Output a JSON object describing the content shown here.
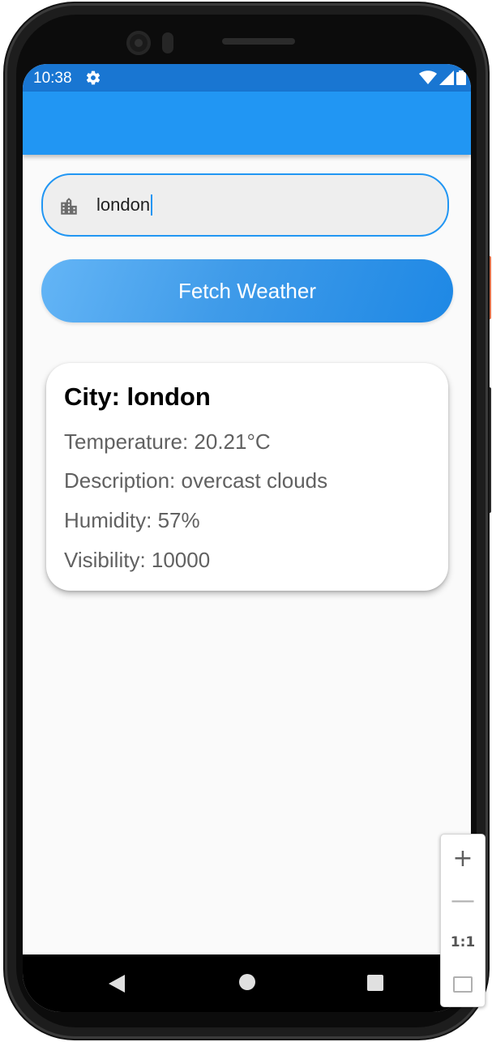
{
  "status_bar": {
    "time": "10:38",
    "icons": [
      "gear-icon",
      "wifi-icon",
      "signal-icon",
      "battery-icon"
    ]
  },
  "search": {
    "icon": "city-icon",
    "value": "london"
  },
  "actions": {
    "fetch_label": "Fetch Weather"
  },
  "weather": {
    "city_line": "City: london",
    "temperature_line": "Temperature: 20.21°C",
    "description_line": "Description: overcast clouds",
    "humidity_line": "Humidity: 57%",
    "visibility_line": "Visibility: 10000"
  },
  "nav": {
    "buttons": [
      "back-icon",
      "home-icon",
      "recents-icon"
    ]
  },
  "zoom_controls": {
    "zoom_in": "+",
    "zoom_out": "—",
    "actual_size": "1:1",
    "fit_icon": "fit-screen-icon"
  },
  "colors": {
    "status_bar": "#1976d2",
    "app_bar": "#2196f3",
    "accent": "#2196f3",
    "background": "#fafafa",
    "button_gradient_start": "#64b5f6",
    "button_gradient_end": "#1e88e5"
  }
}
